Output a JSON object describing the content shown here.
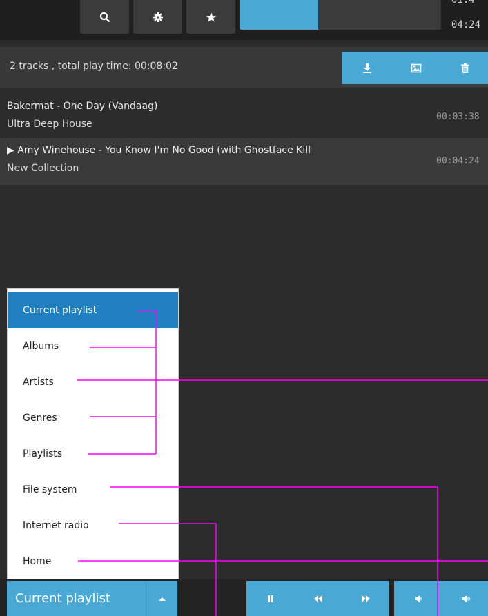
{
  "toolbar": {
    "buttons": [
      {
        "icon": "search-icon"
      },
      {
        "icon": "gear-icon"
      },
      {
        "icon": "star-icon"
      }
    ],
    "progress": {
      "fraction": 0.39
    },
    "time_elapsed": "01:4",
    "time_total": "04:24"
  },
  "playlist_info": {
    "summary": "2 tracks , total play time: 00:08:02",
    "actions": [
      {
        "icon": "download-icon"
      },
      {
        "icon": "image-icon"
      },
      {
        "icon": "trash-icon"
      }
    ]
  },
  "tracks": [
    {
      "title": "Bakermat - One Day (Vandaag)",
      "album": "Ultra Deep House",
      "duration": "00:03:38",
      "playing": false
    },
    {
      "title": "▶ Amy Winehouse - You Know I'm No Good (with Ghostface Kill",
      "album": "New Collection",
      "duration": "00:04:24",
      "playing": true
    }
  ],
  "menu": {
    "items": [
      {
        "label": "Current playlist",
        "active": true
      },
      {
        "label": "Albums",
        "active": false
      },
      {
        "label": "Artists",
        "active": false
      },
      {
        "label": "Genres",
        "active": false
      },
      {
        "label": "Playlists",
        "active": false
      },
      {
        "label": "File system",
        "active": false
      },
      {
        "label": "Internet radio",
        "active": false
      },
      {
        "label": "Home",
        "active": false
      }
    ]
  },
  "bottombar": {
    "view_label": "Current playlist",
    "controls": [
      {
        "icon": "pause-icon"
      },
      {
        "icon": "rewind-icon"
      },
      {
        "icon": "fast-forward-icon"
      },
      {
        "icon": "volume-down-icon"
      },
      {
        "icon": "volume-up-icon"
      }
    ]
  },
  "colors": {
    "accent": "#4aa9d4",
    "menu_active": "#2080c0",
    "annotation": "#ff00ff",
    "background": "#2c2c2c"
  }
}
